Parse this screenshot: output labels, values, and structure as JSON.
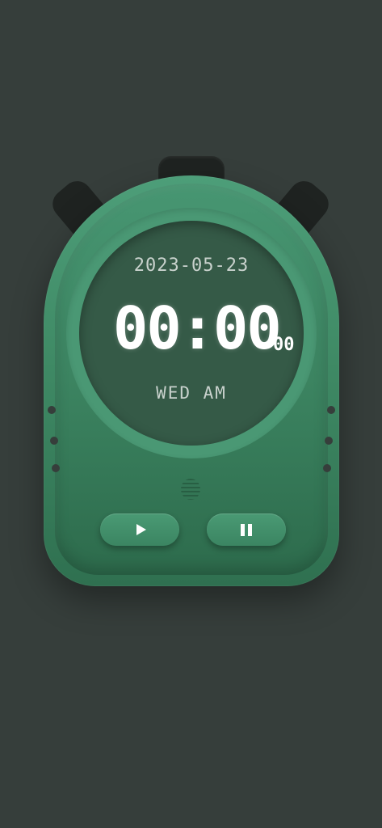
{
  "display": {
    "date": "2023-05-23",
    "time": "00:00",
    "centiseconds": "00",
    "day_period": "WED AM"
  },
  "controls": {
    "play_icon": "play-icon",
    "pause_icon": "pause-icon"
  },
  "colors": {
    "background": "#363e3b",
    "body": "#4a9874",
    "display": "#355a47",
    "digits": "#ffffff",
    "buttons_dark": "#1f2321"
  }
}
